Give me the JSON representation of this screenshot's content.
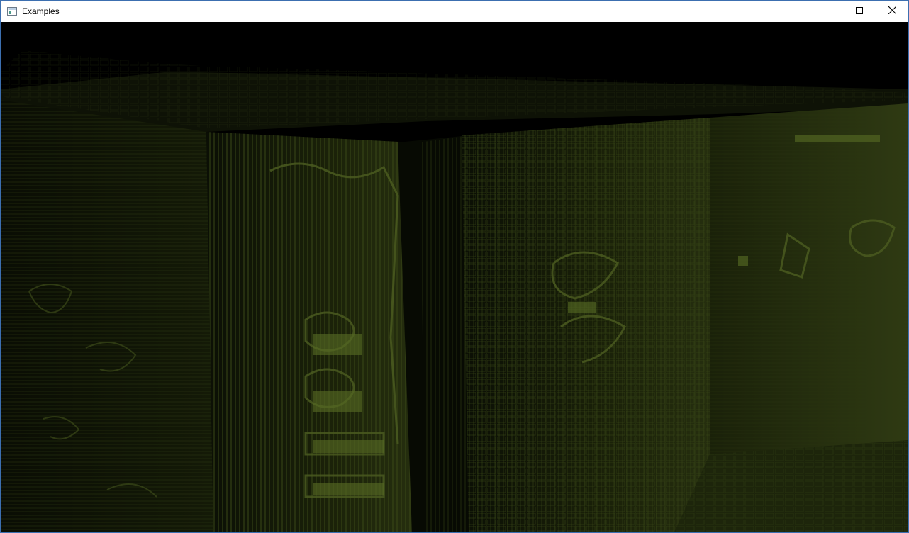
{
  "window": {
    "title": "Examples",
    "icons": {
      "app": "window-app-icon",
      "minimize": "minimize-icon",
      "maximize": "maximize-icon",
      "close": "close-icon"
    }
  },
  "render": {
    "description_color": "#3a4a1c",
    "background": "#000000"
  }
}
